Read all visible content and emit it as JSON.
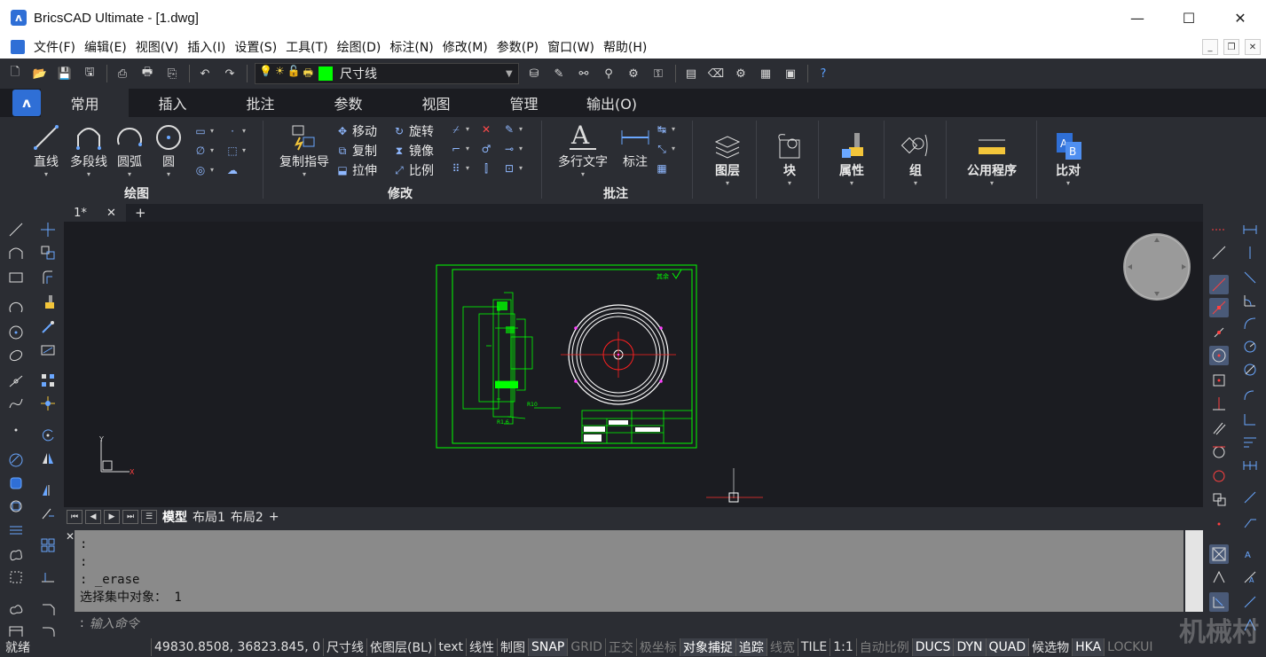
{
  "window": {
    "title": "BricsCAD Ultimate - [1.dwg]",
    "minimize": "—",
    "maximize": "☐",
    "close": "✕"
  },
  "menu": [
    "文件(F)",
    "编辑(E)",
    "视图(V)",
    "插入(I)",
    "设置(S)",
    "工具(T)",
    "绘图(D)",
    "标注(N)",
    "修改(M)",
    "参数(P)",
    "窗口(W)",
    "帮助(H)"
  ],
  "layer": {
    "name": "尺寸线",
    "color": "#00ff00"
  },
  "ribbon_tabs": [
    "常用",
    "插入",
    "批注",
    "参数",
    "视图",
    "管理",
    "输出(O)"
  ],
  "ribbon": {
    "draw": {
      "title": "绘图",
      "line": "直线",
      "polyline": "多段线",
      "arc": "圆弧",
      "circle": "圆"
    },
    "modify": {
      "title": "修改",
      "copy_guide": "复制指导",
      "move": "移动",
      "rotate": "旋转",
      "copy": "复制",
      "mirror": "镜像",
      "stretch": "拉伸",
      "scale": "比例"
    },
    "annotate": {
      "title": "批注",
      "mtext": "多行文字",
      "dimension": "标注"
    },
    "layers": "图层",
    "block": "块",
    "properties": "属性",
    "group": "组",
    "utilities": "公用程序",
    "compare": "比对"
  },
  "doc_tab": {
    "name": "1*",
    "close": "✕",
    "add": "+"
  },
  "layout_tabs": {
    "model": "模型",
    "layout1": "布局1",
    "layout2": "布局2",
    "add": "+"
  },
  "command": {
    "history": [
      ":",
      ":",
      ": _erase",
      "选择集中对象：  1"
    ],
    "prompt": ":",
    "placeholder": "输入命令"
  },
  "status": {
    "ready": "就绪",
    "coords": "49830.8508, 36823.845, 0",
    "items": [
      {
        "label": "尺寸线",
        "state": "plain"
      },
      {
        "label": "依图层(BL)",
        "state": "plain"
      },
      {
        "label": "text",
        "state": "plain"
      },
      {
        "label": "线性",
        "state": "plain"
      },
      {
        "label": "制图",
        "state": "plain"
      },
      {
        "label": "SNAP",
        "state": "on"
      },
      {
        "label": "GRID",
        "state": "off"
      },
      {
        "label": "正交",
        "state": "off"
      },
      {
        "label": "极坐标",
        "state": "off"
      },
      {
        "label": "对象捕捉",
        "state": "on"
      },
      {
        "label": "追踪",
        "state": "on"
      },
      {
        "label": "线宽",
        "state": "off"
      },
      {
        "label": "TILE",
        "state": "plain"
      },
      {
        "label": "1:1",
        "state": "plain"
      },
      {
        "label": "自动比例",
        "state": "off"
      },
      {
        "label": "DUCS",
        "state": "on"
      },
      {
        "label": "DYN",
        "state": "on"
      },
      {
        "label": "QUAD",
        "state": "on"
      },
      {
        "label": "候选物",
        "state": "plain"
      },
      {
        "label": "HKA",
        "state": "on"
      },
      {
        "label": "LOCKUI",
        "state": "off"
      }
    ]
  },
  "drawing_colors": {
    "frame": "#00ff00",
    "part": "#00ff00",
    "circles": "#ffffff",
    "center": "#ff2020",
    "quadrant": "#ff40ff"
  },
  "drawing_text": {
    "tag": "其余",
    "dim1": "R10",
    "dim2": "R1.6"
  },
  "watermark": "机械村"
}
